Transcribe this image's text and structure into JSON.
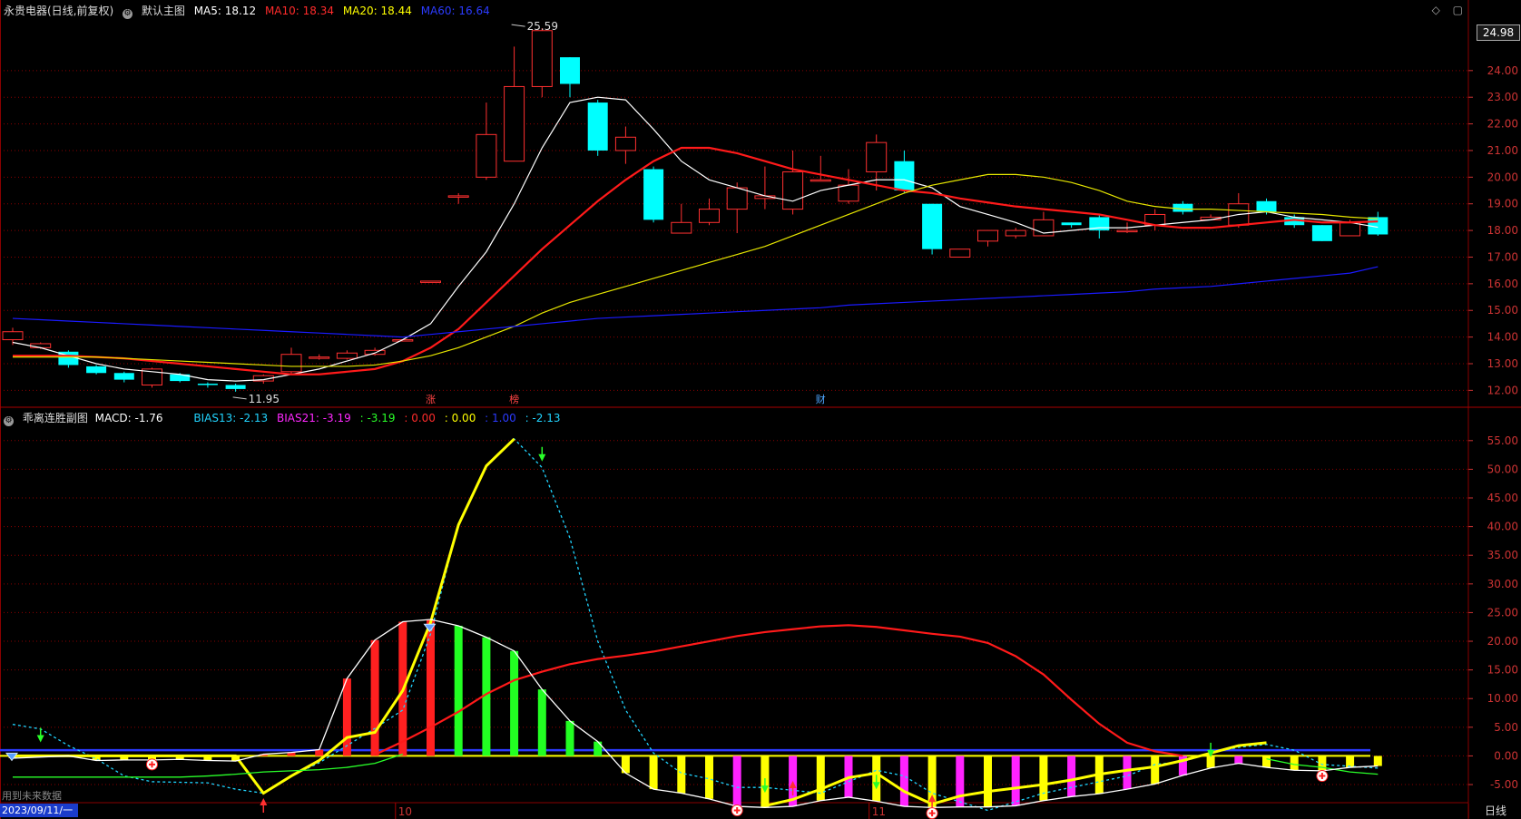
{
  "header": {
    "stock_name": "永贵电器(日线,前复权)",
    "main_indicator": "默认主图",
    "ma_items": [
      {
        "label": "MA5: 18.12",
        "color": "#ffffff"
      },
      {
        "label": "MA10: 18.34",
        "color": "#ff2b2b"
      },
      {
        "label": "MA20: 18.44",
        "color": "#ffff00"
      },
      {
        "label": "MA60: 16.64",
        "color": "#2b3bff"
      }
    ]
  },
  "sub_header": {
    "name": "乖离连胜副图",
    "items": [
      {
        "label": "MACD: -1.76",
        "color": "#ffffff"
      },
      {
        "label": "BIAS13: -2.13",
        "color": "#21d4ff"
      },
      {
        "label": "BIAS21: -3.19",
        "color": "#ff28ff"
      },
      {
        "label": ": -3.19",
        "color": "#29ff29"
      },
      {
        "label": ": 0.00",
        "color": "#ff2b2b"
      },
      {
        "label": ": 0.00",
        "color": "#ffff00"
      },
      {
        "label": ": 1.00",
        "color": "#2b3bff"
      },
      {
        "label": ": -2.13",
        "color": "#21d4ff"
      }
    ]
  },
  "current_price_tag": "24.98",
  "date_tag": "2023/09/11/一",
  "future_data_button": "用到未来数据",
  "period_button": "日线",
  "window_controls": [
    "◇",
    "▢"
  ],
  "colors": {
    "up": "#ff3030",
    "down": "#00ffff",
    "grid": "#8a0000",
    "axis_text": "#cc3333",
    "ma5": "#ffffff",
    "ma10": "#ff1a1a",
    "ma20": "#e6e600",
    "ma60": "#1a1aff"
  },
  "chart_data": [
    {
      "type": "candlestick",
      "title": "默认主图",
      "y_ticks": [
        24.0,
        23.0,
        22.0,
        21.0,
        20.0,
        19.0,
        18.0,
        17.0,
        16.0,
        15.0,
        14.0,
        13.0,
        12.0
      ],
      "ylim": [
        11.4,
        25.9
      ],
      "x_ticks": [
        {
          "index": 14,
          "label": "10"
        },
        {
          "index": 31,
          "label": "11"
        }
      ],
      "annotations": [
        {
          "index": 18,
          "value": 25.59,
          "label": "25.59"
        },
        {
          "index": 8,
          "value": 11.95,
          "label": "11.95"
        }
      ],
      "markers": [
        {
          "index": 15,
          "label": "涨",
          "color": "#ff4444"
        },
        {
          "index": 18,
          "label": "榜",
          "color": "#ff4444"
        },
        {
          "index": 29,
          "label": "财",
          "color": "#4da6ff"
        }
      ],
      "candles": [
        [
          13.9,
          14.2,
          13.7,
          14.35
        ],
        [
          13.6,
          13.75,
          13.55,
          13.8
        ],
        [
          13.45,
          12.95,
          12.85,
          13.5
        ],
        [
          12.9,
          12.65,
          12.6,
          12.95
        ],
        [
          12.65,
          12.4,
          12.3,
          12.7
        ],
        [
          12.2,
          12.8,
          12.1,
          12.85
        ],
        [
          12.6,
          12.35,
          12.3,
          12.65
        ],
        [
          12.25,
          12.2,
          12.1,
          12.3
        ],
        [
          12.2,
          12.05,
          11.95,
          12.25
        ],
        [
          12.35,
          12.55,
          12.25,
          12.6
        ],
        [
          12.7,
          13.35,
          12.6,
          13.6
        ],
        [
          13.2,
          13.25,
          13.15,
          13.35
        ],
        [
          13.2,
          13.4,
          13.15,
          13.5
        ],
        [
          13.35,
          13.5,
          13.3,
          13.6
        ],
        [
          13.9,
          13.9,
          13.9,
          13.9
        ],
        [
          16.1,
          16.1,
          16.1,
          16.1
        ],
        [
          19.3,
          19.3,
          19.0,
          19.4
        ],
        [
          20.0,
          21.6,
          19.9,
          22.8
        ],
        [
          20.6,
          23.4,
          20.6,
          24.9
        ],
        [
          23.4,
          25.5,
          23.0,
          25.59
        ],
        [
          24.5,
          23.5,
          23.0,
          24.5
        ],
        [
          22.8,
          21.0,
          20.8,
          22.9
        ],
        [
          21.0,
          21.5,
          20.5,
          21.9
        ],
        [
          20.3,
          18.4,
          18.3,
          20.4
        ],
        [
          17.9,
          18.3,
          17.9,
          19.0
        ],
        [
          18.3,
          18.8,
          18.2,
          19.2
        ],
        [
          18.8,
          19.6,
          17.9,
          19.8
        ],
        [
          19.2,
          19.3,
          18.8,
          20.4
        ],
        [
          18.8,
          20.2,
          18.6,
          21.0
        ],
        [
          19.9,
          19.9,
          19.9,
          20.8
        ],
        [
          19.1,
          19.7,
          19.0,
          20.3
        ],
        [
          20.2,
          21.3,
          19.5,
          21.6
        ],
        [
          20.6,
          19.5,
          19.4,
          21.0
        ],
        [
          19.0,
          17.3,
          17.1,
          19.0
        ],
        [
          17.0,
          17.3,
          17.0,
          17.3
        ],
        [
          17.6,
          18.0,
          17.4,
          18.0
        ],
        [
          17.8,
          18.0,
          17.7,
          18.1
        ],
        [
          17.8,
          18.4,
          17.8,
          18.7
        ],
        [
          18.3,
          18.2,
          18.1,
          18.3
        ],
        [
          18.5,
          18.0,
          17.7,
          18.6
        ],
        [
          18.0,
          18.0,
          17.9,
          18.3
        ],
        [
          18.2,
          18.6,
          18.0,
          18.8
        ],
        [
          19.0,
          18.7,
          18.6,
          19.1
        ],
        [
          18.4,
          18.5,
          18.4,
          18.6
        ],
        [
          18.2,
          19.0,
          18.1,
          19.4
        ],
        [
          19.1,
          18.7,
          18.6,
          19.2
        ],
        [
          18.5,
          18.2,
          18.1,
          18.6
        ],
        [
          18.2,
          17.6,
          17.6,
          18.2
        ],
        [
          17.8,
          18.3,
          17.8,
          18.4
        ],
        [
          18.5,
          17.85,
          17.8,
          18.7
        ]
      ],
      "series": [
        {
          "name": "MA5",
          "color": "#ffffff",
          "values": [
            13.8,
            13.6,
            13.3,
            13.0,
            12.8,
            12.7,
            12.6,
            12.4,
            12.35,
            12.4,
            12.6,
            12.8,
            13.1,
            13.4,
            13.9,
            14.5,
            15.9,
            17.2,
            19.0,
            21.1,
            22.8,
            23.0,
            22.9,
            21.8,
            20.6,
            19.9,
            19.6,
            19.3,
            19.1,
            19.5,
            19.7,
            19.9,
            19.9,
            19.6,
            18.9,
            18.6,
            18.3,
            17.9,
            18.0,
            18.1,
            18.1,
            18.2,
            18.3,
            18.4,
            18.6,
            18.7,
            18.5,
            18.4,
            18.3,
            18.12
          ]
        },
        {
          "name": "MA10",
          "color": "#ff1a1a",
          "values": [
            13.3,
            13.3,
            13.3,
            13.25,
            13.2,
            13.1,
            13.0,
            12.9,
            12.8,
            12.7,
            12.6,
            12.6,
            12.7,
            12.8,
            13.1,
            13.6,
            14.3,
            15.3,
            16.3,
            17.3,
            18.2,
            19.1,
            19.9,
            20.6,
            21.1,
            21.1,
            20.9,
            20.6,
            20.3,
            20.1,
            19.9,
            19.7,
            19.5,
            19.4,
            19.2,
            19.05,
            18.9,
            18.8,
            18.7,
            18.6,
            18.4,
            18.2,
            18.1,
            18.1,
            18.2,
            18.3,
            18.4,
            18.3,
            18.3,
            18.34
          ]
        },
        {
          "name": "MA20",
          "color": "#e6e600",
          "values": [
            13.25,
            13.25,
            13.25,
            13.25,
            13.2,
            13.15,
            13.1,
            13.05,
            13.0,
            12.95,
            12.9,
            12.9,
            12.9,
            12.95,
            13.1,
            13.3,
            13.6,
            14.0,
            14.4,
            14.9,
            15.3,
            15.6,
            15.9,
            16.2,
            16.5,
            16.8,
            17.1,
            17.4,
            17.8,
            18.2,
            18.6,
            19.0,
            19.4,
            19.7,
            19.9,
            20.1,
            20.1,
            20.0,
            19.8,
            19.5,
            19.1,
            18.9,
            18.8,
            18.8,
            18.75,
            18.7,
            18.65,
            18.6,
            18.5,
            18.44
          ]
        },
        {
          "name": "MA60",
          "color": "#1a1aff",
          "values": [
            14.7,
            14.65,
            14.6,
            14.55,
            14.5,
            14.45,
            14.4,
            14.35,
            14.3,
            14.25,
            14.2,
            14.15,
            14.1,
            14.05,
            14.0,
            14.1,
            14.2,
            14.3,
            14.4,
            14.5,
            14.6,
            14.7,
            14.75,
            14.8,
            14.85,
            14.9,
            14.95,
            15.0,
            15.05,
            15.1,
            15.2,
            15.25,
            15.3,
            15.35,
            15.4,
            15.45,
            15.5,
            15.55,
            15.6,
            15.65,
            15.7,
            15.8,
            15.85,
            15.9,
            16.0,
            16.1,
            16.2,
            16.3,
            16.4,
            16.64
          ]
        }
      ]
    },
    {
      "type": "bar+line",
      "title": "乖离连胜副图",
      "y_ticks": [
        55.0,
        50.0,
        45.0,
        40.0,
        35.0,
        30.0,
        25.0,
        20.0,
        15.0,
        10.0,
        5.0,
        0.0,
        -5.0
      ],
      "ylim": [
        -8.0,
        57.5
      ],
      "macd_bars": [
        -0.4,
        -0.2,
        0,
        -0.8,
        -0.7,
        -0.7,
        -0.6,
        -0.8,
        -0.9,
        0.3,
        0.6,
        1.1,
        13.5,
        20.2,
        23.4,
        23.8,
        22.7,
        20.7,
        18.3,
        11.6,
        6.1,
        2.5,
        -3.0,
        -5.8,
        -6.5,
        -7.5,
        -8.8,
        -9.0,
        -8.8,
        -7.8,
        -7.2,
        -7.9,
        -8.8,
        -9.0,
        -8.9,
        -8.9,
        -8.7,
        -7.8,
        -7.1,
        -6.6,
        -5.8,
        -4.9,
        -3.4,
        -2.1,
        -1.3,
        -2.0,
        -2.5,
        -2.6,
        -2.0,
        -1.76
      ],
      "series": [
        {
          "name": "BIAS13",
          "color": "#21d4ff",
          "dash": true,
          "values": [
            5.5,
            4.7,
            1.8,
            -0.5,
            -3.5,
            -4.5,
            -4.6,
            -4.7,
            -5.8,
            -6.5,
            -3.5,
            -1.2,
            1.8,
            4.8,
            8.0,
            21.3,
            40.6,
            50.6,
            55.3,
            50.3,
            38.0,
            20.0,
            8.0,
            0.5,
            -3.0,
            -4.0,
            -5.5,
            -5.5,
            -6.0,
            -6.5,
            -4.5,
            -2.5,
            -3.5,
            -6.5,
            -8.0,
            -9.5,
            -8.0,
            -6.5,
            -5.5,
            -4.5,
            -3.5,
            -1.5,
            -1.0,
            0.5,
            1.5,
            2.0,
            1.0,
            -1.5,
            -1.8,
            -2.13
          ]
        },
        {
          "name": "BIAS21",
          "color": "#ffff00",
          "values": [
            0,
            0,
            0,
            0,
            0,
            0,
            0,
            0,
            0,
            -6.5,
            -3.5,
            -0.8,
            3.2,
            4.1,
            11.4,
            23.3,
            40.3,
            50.6,
            55.3,
            null,
            null,
            null,
            null,
            null,
            null,
            null,
            null,
            -8.7,
            -7.6,
            -5.8,
            -3.8,
            -3.0,
            -6.2,
            -8.4,
            -7.0,
            -6.2,
            -5.6,
            -5.0,
            -4.2,
            -3.2,
            -2.5,
            -1.9,
            -0.8,
            0.5,
            1.8,
            2.3,
            null,
            null,
            null,
            null
          ]
        },
        {
          "name": "L3",
          "color": "#ff1a1a",
          "values": [
            null,
            null,
            null,
            null,
            null,
            null,
            null,
            null,
            null,
            null,
            null,
            null,
            null,
            0.2,
            2.5,
            5.0,
            7.7,
            10.8,
            13.2,
            14.7,
            16.0,
            16.9,
            17.5,
            18.2,
            19.1,
            20.0,
            20.9,
            21.6,
            22.1,
            22.6,
            22.8,
            22.5,
            21.9,
            21.3,
            20.8,
            19.7,
            17.4,
            14.2,
            9.8,
            5.6,
            2.3,
            0.8,
            0,
            null,
            null,
            null,
            null,
            null,
            null,
            null
          ]
        },
        {
          "name": "L4",
          "color": "#29ff29",
          "values": [
            -3.7,
            -3.7,
            -3.7,
            -3.7,
            -3.7,
            -3.7,
            -3.7,
            -3.5,
            -3.2,
            -2.8,
            -2.6,
            -2.4,
            -2.0,
            -1.3,
            0.3,
            null,
            null,
            null,
            null,
            null,
            null,
            null,
            null,
            null,
            null,
            null,
            null,
            null,
            null,
            null,
            null,
            null,
            null,
            null,
            null,
            null,
            null,
            null,
            null,
            null,
            null,
            null,
            null,
            null,
            null,
            -0.5,
            -1.5,
            -2.0,
            -2.8,
            -3.19
          ]
        },
        {
          "name": "MACD-env",
          "color": "#ffffff",
          "values": [
            -0.4,
            -0.2,
            0,
            -0.8,
            -0.7,
            -0.7,
            -0.6,
            -0.8,
            -0.9,
            0.3,
            0.6,
            1.1,
            13.5,
            20.2,
            23.4,
            23.8,
            22.7,
            20.7,
            18.3,
            11.6,
            6.1,
            2.5,
            -3.0,
            -5.8,
            -6.5,
            -7.5,
            -8.8,
            -9.0,
            -8.8,
            -7.8,
            -7.2,
            -7.9,
            -8.8,
            -9.0,
            -8.9,
            -8.9,
            -8.7,
            -7.8,
            -7.1,
            -6.6,
            -5.8,
            -4.9,
            -3.4,
            -2.1,
            -1.3,
            -2.0,
            -2.5,
            -2.6,
            -2.0,
            -1.76
          ]
        }
      ],
      "flat_lines": [
        {
          "value": 1.0,
          "color": "#2b3bff"
        },
        {
          "value": 0.0,
          "color": "#ffff00"
        }
      ]
    }
  ]
}
